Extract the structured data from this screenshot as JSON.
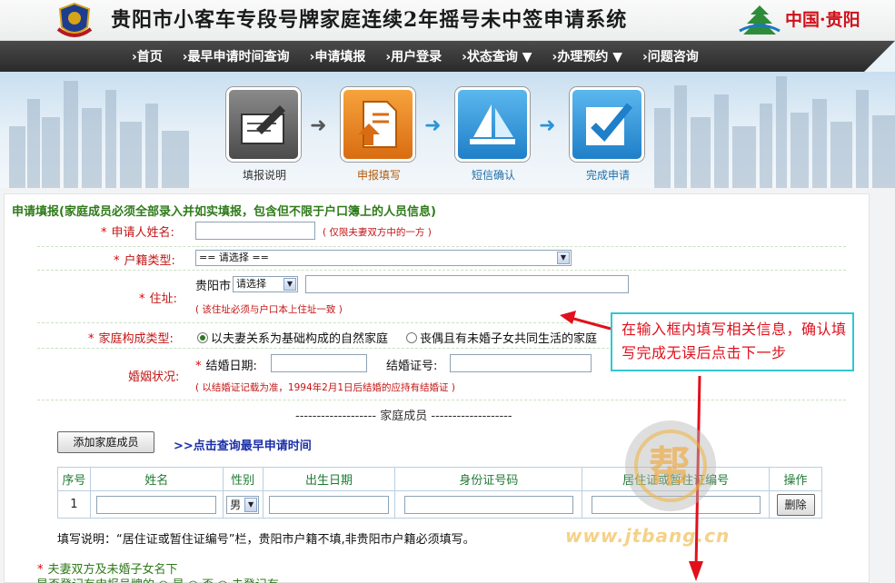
{
  "header": {
    "site_title": "贵阳市小客车专段号牌家庭连续2年摇号未中签申请系统",
    "brand_text": "中国·贵阳"
  },
  "nav": {
    "items": [
      "›首页",
      "›最早申请时间查询",
      "›申请填报",
      "›用户登录",
      "›状态查询 ▼",
      "›办理预约 ▼",
      "›问题咨询"
    ]
  },
  "steps": [
    {
      "label": "填报说明",
      "icon": "form-pen-icon"
    },
    {
      "label": "申报填写",
      "icon": "document-upload-icon"
    },
    {
      "label": "短信确认",
      "icon": "paper-plane-icon"
    },
    {
      "label": "完成申请",
      "icon": "checkmark-icon"
    }
  ],
  "form": {
    "heading": "申请填报(家庭成员必须全部录入并如实填报，包含但不限于户口簿上的人员信息)",
    "applicant_name_label": "申请人姓名:",
    "applicant_name_note": "( 仅限夫妻双方中的一方 )",
    "household_type_label": "户籍类型:",
    "household_type_value": "== 请选择 ==",
    "address_label": "住址:",
    "address_city": "贵阳市",
    "address_district_value": "请选择",
    "address_note": "( 该住址必须与户口本上住址一致 )",
    "family_type_label": "家庭构成类型:",
    "family_type_options": [
      "以夫妻关系为基础构成的自然家庭",
      "丧偶且有未婚子女共同生活的家庭"
    ],
    "marital_label": "婚姻状况:",
    "marriage_date_label": "结婚日期:",
    "marriage_cert_label": "结婚证号:",
    "marriage_note": "( 以结婚证记载为准，1994年2月1日后结婚的应持有结婚证 )",
    "members_title": "------------------- 家庭成员 -------------------",
    "add_member_button": "添加家庭成员",
    "query_link": ">>点击查询最早申请时间",
    "table_headers": [
      "序号",
      "姓名",
      "性别",
      "出生日期",
      "身份证号码",
      "居住证或暂住证编号",
      "操作"
    ],
    "row": {
      "index": "1",
      "gender": "男",
      "delete_button": "删除"
    },
    "fill_note": "填写说明：“居住证或暂住证编号”栏，贵阳市户籍不填,非贵阳市户籍必须填写。",
    "spouse_label": "夫妻双方及未婚子女名下",
    "cut_off_text": "是否登记有申报号牌的 ○ 是  ○ 否 ○ 未登记有"
  },
  "callout": {
    "text": "在输入框内填写相关信息，确认填写完成无误后点击下一步"
  },
  "watermark": "www.jtbang.cn",
  "watermark_badge": "帮",
  "colors": {
    "nav_bg": "#333333",
    "heading_green": "#2d7a18",
    "label_red": "#c31616",
    "callout_border": "#30c7d2",
    "arrow_red": "#e0101c"
  }
}
